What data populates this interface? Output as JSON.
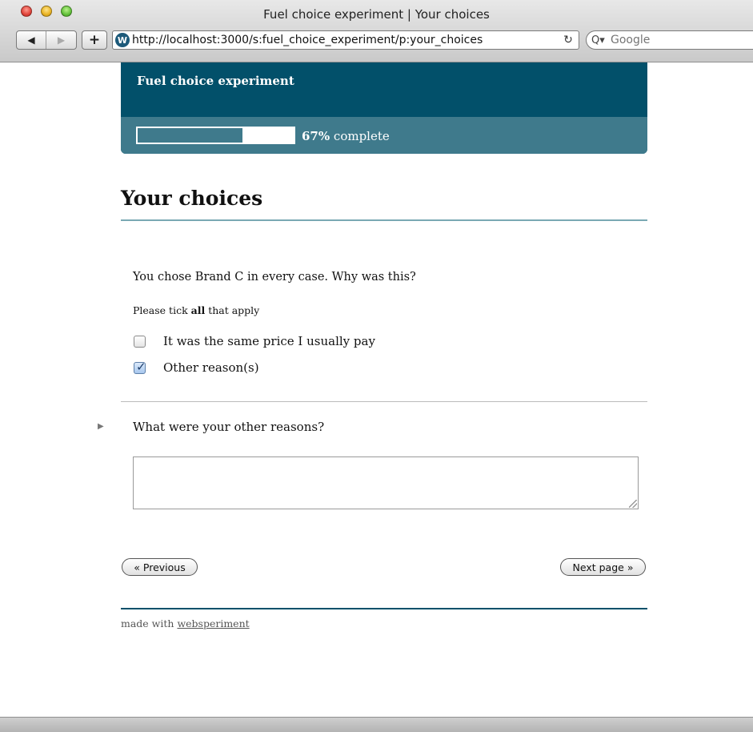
{
  "window": {
    "title": "Fuel choice experiment | Your choices"
  },
  "toolbar": {
    "back_label": "◀",
    "forward_label": "▶",
    "add_label": "+",
    "site_icon": "W",
    "url": "http://localhost:3000/s:fuel_choice_experiment/p:your_choices",
    "reload_label": "↻",
    "search_icon": "Q▾",
    "search_placeholder": "Google"
  },
  "header": {
    "site_title": "Fuel choice experiment",
    "progress_percent": 67,
    "progress_value_label": "67%",
    "progress_suffix": "complete"
  },
  "main": {
    "heading": "Your choices",
    "question": "You chose Brand C in every case. Why was this?",
    "instruction_prefix": "Please tick ",
    "instruction_bold": "all",
    "instruction_suffix": " that apply",
    "options": [
      {
        "label": "It was the same price I usually pay",
        "checked": false
      },
      {
        "label": "Other reason(s)",
        "checked": true
      }
    ],
    "followup_question": "What were your other reasons?",
    "followup_answer": ""
  },
  "navigation": {
    "previous_label": "« Previous",
    "next_label": "Next page »"
  },
  "footer": {
    "prefix": "made with ",
    "link_text": "websperiment"
  }
}
